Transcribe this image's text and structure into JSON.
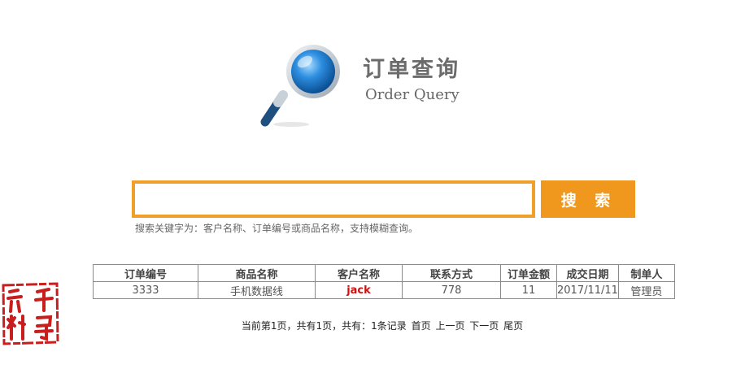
{
  "header": {
    "title_cn": "订单查询",
    "title_en": "Order Query"
  },
  "search": {
    "value": "",
    "placeholder": "",
    "button_label": "搜 索",
    "hint": "搜索关键字为：客户名称、订单编号或商品名称，支持模糊查询。"
  },
  "table": {
    "columns": [
      "订单编号",
      "商品名称",
      "客户名称",
      "联系方式",
      "订单金额",
      "成交日期",
      "制单人"
    ],
    "rows": [
      [
        "3333",
        "手机数据线",
        "jack",
        "778",
        "11",
        "2017/11/11",
        "管理员"
      ]
    ]
  },
  "pager": {
    "summary": "当前第1页，共有1页，共有：1条记录",
    "first": "首页",
    "prev": "上一页",
    "next": "下一页",
    "last": "尾页"
  },
  "watermark": {
    "text": "千寻资料",
    "color": "#c81e1e"
  },
  "colors": {
    "accent": "#f0981d",
    "input_border": "#f0a02a",
    "customer_text": "#cc1111",
    "lens": "#2b7fc6"
  },
  "icons": {
    "logo": "magnifier-icon"
  }
}
